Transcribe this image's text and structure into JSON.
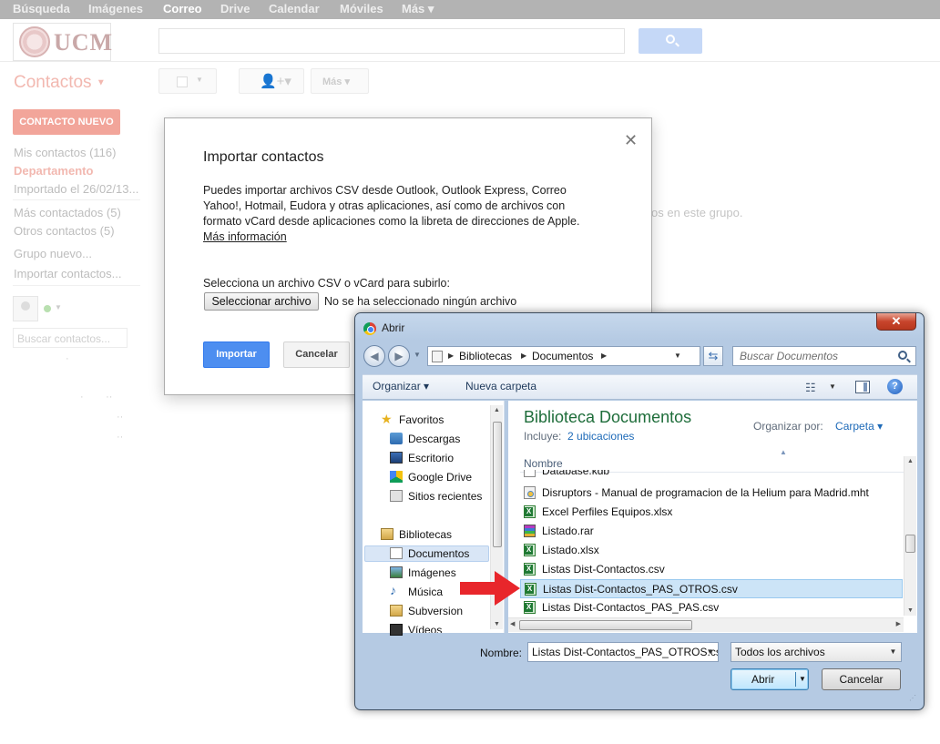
{
  "topbar": {
    "items": [
      "Búsqueda",
      "Imágenes",
      "Correo",
      "Drive",
      "Calendar",
      "Móviles",
      "Más ▾"
    ],
    "active": "Correo"
  },
  "logo": {
    "text": "UCM"
  },
  "colors": {
    "accent": "#f2a59a",
    "google_blue": "#4d8ef0",
    "win_frame": "#b5cae3",
    "selection": "#cce4f7",
    "arrow": "#e8262b"
  },
  "contacts": {
    "title": "Contactos",
    "new_contact": "CONTACTO NUEVO",
    "toolbar_more": "Más",
    "sidebar": [
      "Mis contactos (116)",
      "Departamento",
      "Importado el 26/02/13...",
      "Más contactados (5)",
      "Otros contactos (5)",
      "Grupo nuevo...",
      "Importar contactos..."
    ],
    "search_placeholder": "Buscar contactos...",
    "group_message": "os en este grupo."
  },
  "import_dialog": {
    "title": "Importar contactos",
    "description": "Puedes importar archivos CSV desde Outlook, Outlook Express, Correo Yahoo!, Hotmail, Eudora y otras aplicaciones, así como de archivos con formato vCard desde aplicaciones como la libreta de direcciones de Apple.",
    "more_info": "Más información",
    "select_label": "Selecciona un archivo CSV o vCard para subirlo:",
    "choose_file": "Seleccionar archivo",
    "no_file": "No se ha seleccionado ningún archivo",
    "import_button": "Importar",
    "cancel_button": "Cancelar",
    "close": "✕"
  },
  "open_dialog": {
    "title": "Abrir",
    "close": "✕",
    "breadcrumb": [
      "Bibliotecas",
      "Documentos"
    ],
    "search_placeholder": "Buscar Documentos",
    "organize": "Organizar ▾",
    "new_folder": "Nueva carpeta",
    "nav": {
      "favorites": "Favoritos",
      "fav_items": [
        "Descargas",
        "Escritorio",
        "Google Drive",
        "Sitios recientes"
      ],
      "libraries": "Bibliotecas",
      "lib_items": [
        "Documentos",
        "Imágenes",
        "Música",
        "Subversion",
        "Vídeos"
      ]
    },
    "library_title": "Biblioteca Documentos",
    "includes_label": "Incluye:",
    "includes_value": "2 ubicaciones",
    "arrange_label": "Organizar por:",
    "arrange_value": "Carpeta ▾",
    "column_name": "Nombre",
    "files": [
      {
        "name": "Database.kdb",
        "icon": "db-file-icon"
      },
      {
        "name": "Disruptors - Manual de programacion de la Helium para Madrid.mht",
        "icon": "mht-file-icon"
      },
      {
        "name": "Excel Perfiles Equipos.xlsx",
        "icon": "excel-file-icon"
      },
      {
        "name": "Listado.rar",
        "icon": "rar-file-icon"
      },
      {
        "name": "Listado.xlsx",
        "icon": "excel-file-icon"
      },
      {
        "name": "Listas Dist-Contactos.csv",
        "icon": "excel-file-icon"
      },
      {
        "name": "Listas Dist-Contactos_PAS_OTROS.csv",
        "icon": "excel-file-icon",
        "selected": true
      },
      {
        "name": "Listas Dist-Contactos_PAS_PAS.csv",
        "icon": "excel-file-icon"
      }
    ],
    "name_label": "Nombre:",
    "name_value": "Listas Dist-Contactos_PAS_OTROS.csv",
    "file_type": "Todos los archivos",
    "open_button": "Abrir",
    "cancel_button": "Cancelar"
  }
}
